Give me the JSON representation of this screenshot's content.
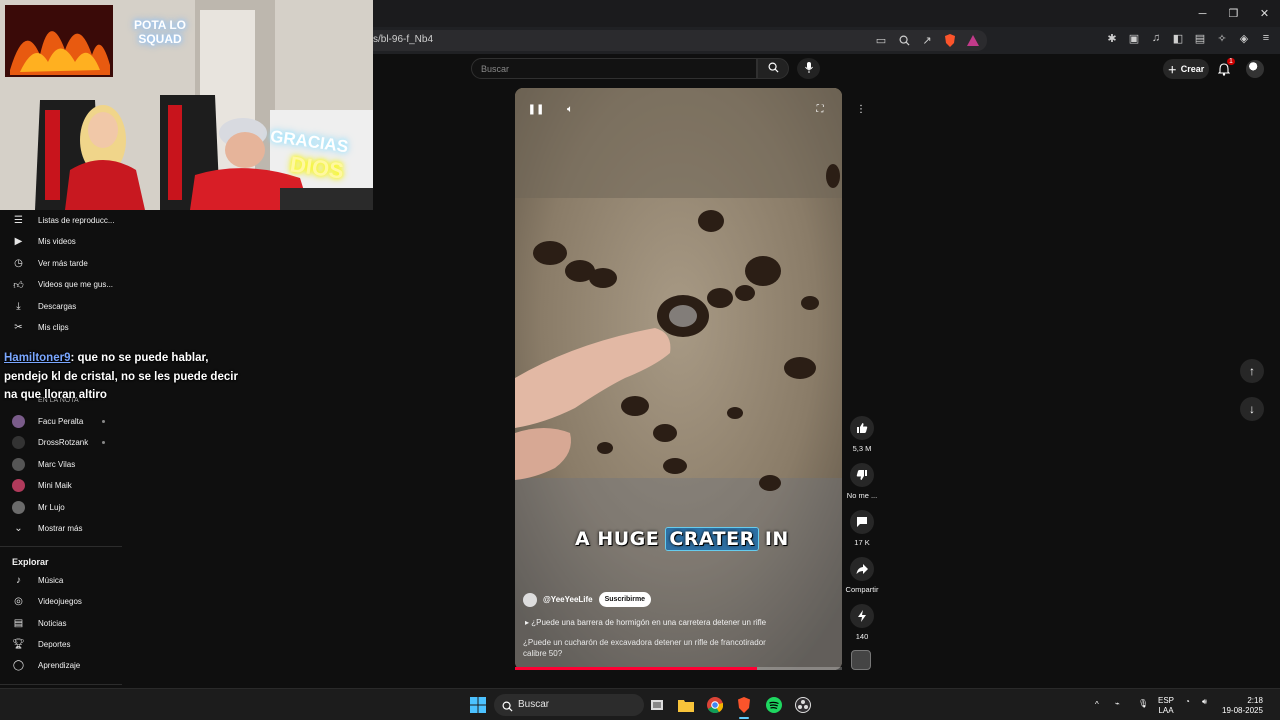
{
  "browser": {
    "url": "s/bl-96-f_Nb4",
    "window_controls": [
      "─",
      "❐",
      "✕"
    ]
  },
  "youtube": {
    "search_placeholder": "Buscar",
    "create_label": "Crear",
    "notification_count": "1"
  },
  "sidebar": {
    "items": [
      {
        "label": "Listas de reproducc...",
        "icon": "playlist-icon"
      },
      {
        "label": "Mis videos",
        "icon": "video-icon"
      },
      {
        "label": "Ver más tarde",
        "icon": "clock-icon"
      },
      {
        "label": "Videos que me gus...",
        "icon": "thumbs-up-icon"
      },
      {
        "label": "Descargas",
        "icon": "download-icon"
      },
      {
        "label": "Mis clips",
        "icon": "scissors-icon"
      }
    ],
    "subscriptions_partial": "EN LA NOTA",
    "subscriptions": [
      {
        "label": "Facu Peralta",
        "color": "#7a5c8a"
      },
      {
        "label": "DrossRotzank",
        "color": "#333333"
      },
      {
        "label": "Marc Vilas",
        "color": "#555555"
      },
      {
        "label": "Mini Maik",
        "color": "#b03a5b"
      },
      {
        "label": "Mr Lujo",
        "color": "#6b6b6b"
      }
    ],
    "show_more": "Mostrar más",
    "explore_title": "Explorar",
    "explore": [
      {
        "label": "Música",
        "icon": "music-icon"
      },
      {
        "label": "Videojuegos",
        "icon": "gamepad-icon"
      },
      {
        "label": "Noticias",
        "icon": "news-icon"
      },
      {
        "label": "Deportes",
        "icon": "trophy-icon"
      },
      {
        "label": "Aprendizaje",
        "icon": "lightbulb-icon"
      }
    ]
  },
  "chat": {
    "user": "Hamiltoner9",
    "message": ": que no se puede hablar, pendejo kl de cristal, no se les puede decir na que lloran altiro"
  },
  "webcam": {
    "neon_sign_1": "POTA LO SQUAD",
    "neon_sign_2": "GRACIAS",
    "neon_sign_3": "DIOS"
  },
  "short": {
    "caption_before": "A HUGE",
    "caption_highlight": "CRATER",
    "caption_after": "IN",
    "channel": "@YeeYeeLife",
    "subscribe": "Suscribirme",
    "related": "¿Puede una barrera de hormigón en una carretera detener un rifle",
    "description": "¿Puede un cucharón de excavadora detener un rifle de francotirador calibre 50?",
    "progress": 0.74
  },
  "actions": {
    "likes": "5,3 M",
    "dislike": "No me ...",
    "comments": "17 K",
    "share": "Compartir",
    "remix": "140"
  },
  "taskbar": {
    "search": "Buscar",
    "lang_1": "ESP",
    "lang_2": "LAA",
    "time": "2:18",
    "date": "19-08-2025"
  }
}
